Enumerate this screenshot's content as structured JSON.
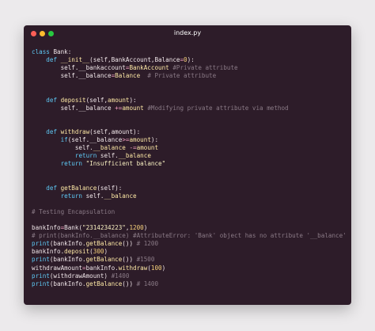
{
  "window": {
    "title": "index.py"
  },
  "code_lines": [
    [
      [
        "kw",
        "class "
      ],
      [
        "tx",
        "Bank:"
      ]
    ],
    [
      [
        "tx",
        "    "
      ],
      [
        "kw",
        "def "
      ],
      [
        "fn",
        "__init__"
      ],
      [
        "tx",
        "(self,BankAccount,Balance"
      ],
      [
        "op",
        "="
      ],
      [
        "num",
        "0"
      ],
      [
        "tx",
        "):"
      ]
    ],
    [
      [
        "tx",
        "        self.__bankaccount"
      ],
      [
        "op",
        "="
      ],
      [
        "fn",
        "BankAccount"
      ],
      [
        "cm",
        " #Private attribute"
      ]
    ],
    [
      [
        "tx",
        "        self.__balance"
      ],
      [
        "op",
        "="
      ],
      [
        "fn",
        "Balance"
      ],
      [
        "cm",
        "  # Private attribute"
      ]
    ],
    [],
    [],
    [
      [
        "tx",
        "    "
      ],
      [
        "kw",
        "def "
      ],
      [
        "fn",
        "deposit"
      ],
      [
        "tx",
        "(self,"
      ],
      [
        "fn",
        "amount"
      ],
      [
        "tx",
        "):"
      ]
    ],
    [
      [
        "tx",
        "        self.__balance "
      ],
      [
        "op",
        "+="
      ],
      [
        "fn",
        "amount"
      ],
      [
        "cm",
        " #Modifying private attribute via method"
      ]
    ],
    [],
    [],
    [
      [
        "tx",
        "    "
      ],
      [
        "kw",
        "def "
      ],
      [
        "fn",
        "withdraw"
      ],
      [
        "tx",
        "(self,amount):"
      ]
    ],
    [
      [
        "tx",
        "        "
      ],
      [
        "kw",
        "if"
      ],
      [
        "tx",
        "(self.__balance"
      ],
      [
        "op",
        ">="
      ],
      [
        "fn",
        "amount"
      ],
      [
        "tx",
        "):"
      ]
    ],
    [
      [
        "tx",
        "            self."
      ],
      [
        "fn",
        "__balance"
      ],
      [
        "tx",
        " "
      ],
      [
        "op",
        "-="
      ],
      [
        "fn",
        "amount"
      ]
    ],
    [
      [
        "tx",
        "            "
      ],
      [
        "kw",
        "return "
      ],
      [
        "tx",
        "self."
      ],
      [
        "fn",
        "__balance"
      ]
    ],
    [
      [
        "tx",
        "        "
      ],
      [
        "kw",
        "return "
      ],
      [
        "str",
        "\"Insufficient balance\""
      ]
    ],
    [],
    [],
    [
      [
        "tx",
        "    "
      ],
      [
        "kw",
        "def "
      ],
      [
        "fn",
        "getBalance"
      ],
      [
        "tx",
        "(self):"
      ]
    ],
    [
      [
        "tx",
        "        "
      ],
      [
        "kw",
        "return "
      ],
      [
        "tx",
        "self."
      ],
      [
        "fn",
        "__balance"
      ]
    ],
    [],
    [
      [
        "cm",
        "# Testing Encapsulation"
      ]
    ],
    [],
    [
      [
        "tx",
        "bankInfo"
      ],
      [
        "op",
        "="
      ],
      [
        "tx",
        "Bank("
      ],
      [
        "str",
        "\"2314234223\""
      ],
      [
        "tx",
        ","
      ],
      [
        "num",
        "1200"
      ],
      [
        "tx",
        ")"
      ]
    ],
    [
      [
        "cm",
        "# print(bankInfo.__balance) #AttributeError: 'Bank' object has no attribute '__balance'"
      ]
    ],
    [
      [
        "kw",
        "print"
      ],
      [
        "tx",
        "(bankInfo."
      ],
      [
        "fn",
        "getBalance"
      ],
      [
        "tx",
        "()) "
      ],
      [
        "cm",
        "# 1200"
      ]
    ],
    [
      [
        "tx",
        "bankInfo."
      ],
      [
        "fn",
        "deposit"
      ],
      [
        "tx",
        "("
      ],
      [
        "num",
        "300"
      ],
      [
        "tx",
        ")"
      ]
    ],
    [
      [
        "kw",
        "print"
      ],
      [
        "tx",
        "(bankInfo."
      ],
      [
        "fn",
        "getBalance"
      ],
      [
        "tx",
        "()) "
      ],
      [
        "cm",
        "#1500"
      ]
    ],
    [
      [
        "tx",
        "withdrawAmount"
      ],
      [
        "op",
        "="
      ],
      [
        "tx",
        "bankInfo."
      ],
      [
        "fn",
        "withdraw"
      ],
      [
        "tx",
        "("
      ],
      [
        "num",
        "100"
      ],
      [
        "tx",
        ")"
      ]
    ],
    [
      [
        "kw",
        "print"
      ],
      [
        "tx",
        "(withdrawAmount) "
      ],
      [
        "cm",
        "#1400"
      ]
    ],
    [
      [
        "kw",
        "print"
      ],
      [
        "tx",
        "(bankInfo."
      ],
      [
        "fn",
        "getBalance"
      ],
      [
        "tx",
        "()) "
      ],
      [
        "cm",
        "# 1400"
      ]
    ]
  ]
}
